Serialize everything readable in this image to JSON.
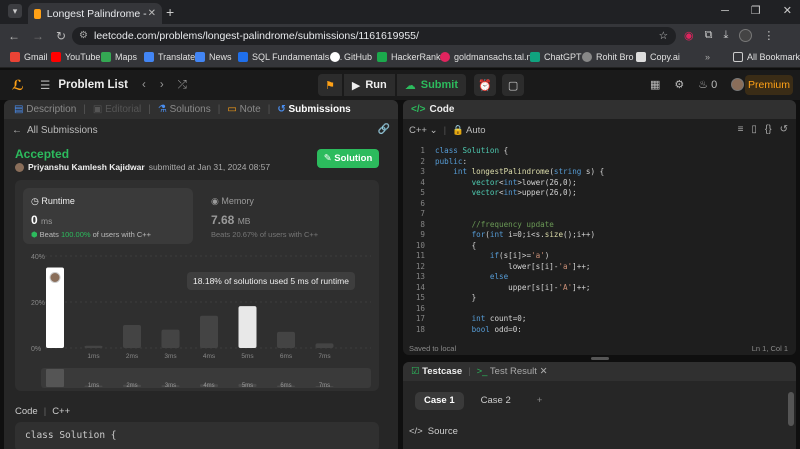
{
  "browser": {
    "tab_title": "Longest Palindrome - LeetCode",
    "url": "leetcode.com/problems/longest-palindrome/submissions/1161619955/",
    "bookmarks": [
      {
        "label": "Gmail",
        "color": "#ea4335"
      },
      {
        "label": "YouTube",
        "color": "#ff0000"
      },
      {
        "label": "Maps",
        "color": "#34a853"
      },
      {
        "label": "Translate",
        "color": "#4285f4"
      },
      {
        "label": "News",
        "color": "#4285f4"
      },
      {
        "label": "SQL Fundamentals -...",
        "color": "#1f6feb"
      },
      {
        "label": "GitHub",
        "color": "#ffffff"
      },
      {
        "label": "HackerRank",
        "color": "#1ba94c"
      },
      {
        "label": "goldmansachs.tal.net",
        "color": "#e0245e"
      },
      {
        "label": "ChatGPT",
        "color": "#10a37f"
      },
      {
        "label": "Rohit Bro",
        "color": "#888888"
      },
      {
        "label": "Copy.ai",
        "color": "#dddddd"
      }
    ],
    "all_bookmarks": "All Bookmarks"
  },
  "header": {
    "problem_list": "Problem List",
    "run": "Run",
    "submit": "Submit",
    "coins": "0",
    "premium": "Premium"
  },
  "left_tabs": {
    "description": "Description",
    "editorial": "Editorial",
    "solutions": "Solutions",
    "note": "Note",
    "submissions": "Submissions"
  },
  "submission": {
    "back": "All Submissions",
    "status": "Accepted",
    "user": "Priyanshu Kamlesh Kajidwar",
    "submitted": "submitted at Jan 31, 2024 08:57",
    "solution_button": "Solution",
    "runtime": {
      "label": "Runtime",
      "value": "0",
      "unit": "ms",
      "beats_prefix": "Beats",
      "beats": "100.00%",
      "beats_suffix": "of users with C++"
    },
    "memory": {
      "label": "Memory",
      "value": "7.68",
      "unit": "MB",
      "beats_prefix": "Beats",
      "beats": "20.67%",
      "beats_suffix": "of users with C++"
    },
    "tooltip": "18.18% of solutions used 5 ms of runtime",
    "code_label": "Code",
    "code_lang": "C++",
    "code_preview": "class Solution {"
  },
  "chart_data": {
    "type": "bar",
    "categories": [
      "0ms",
      "1ms",
      "2ms",
      "3ms",
      "4ms",
      "5ms",
      "6ms",
      "7ms"
    ],
    "tick_labels": [
      "1ms",
      "2ms",
      "3ms",
      "4ms",
      "5ms",
      "6ms",
      "7ms"
    ],
    "values": [
      35,
      1,
      10,
      8,
      14,
      18.18,
      7,
      2
    ],
    "ylim": [
      0,
      40
    ],
    "yticks": [
      "40%",
      "20%",
      "0%"
    ],
    "highlight": "0ms",
    "colors": {
      "bar": "#444444",
      "highlight": "#ffffff",
      "selected": "#e8e8e8"
    },
    "minimap_values": [
      40,
      3,
      5,
      4,
      6,
      7,
      3,
      2
    ]
  },
  "editor": {
    "title": "Code",
    "language": "C++",
    "mode": "Auto",
    "saved": "Saved to local",
    "position": "Ln 1, Col 1",
    "lines": [
      "class Solution {",
      "public:",
      "    int longestPalindrome(string s) {",
      "        vector<int>lower(26,0);",
      "        vector<int>upper(26,0);",
      "",
      "",
      "        //frequency update",
      "        for(int i=0;i<s.size();i++)",
      "        {",
      "            if(s[i]>='a')",
      "                lower[s[i]-'a']++;",
      "            else",
      "                upper[s[i]-'A']++;",
      "        }",
      "",
      "        int count=0;",
      "        bool odd=0;"
    ]
  },
  "testcase": {
    "tab": "Testcase",
    "result_tab": "Test Result",
    "cases": [
      "Case 1",
      "Case 2"
    ],
    "source": "Source"
  }
}
